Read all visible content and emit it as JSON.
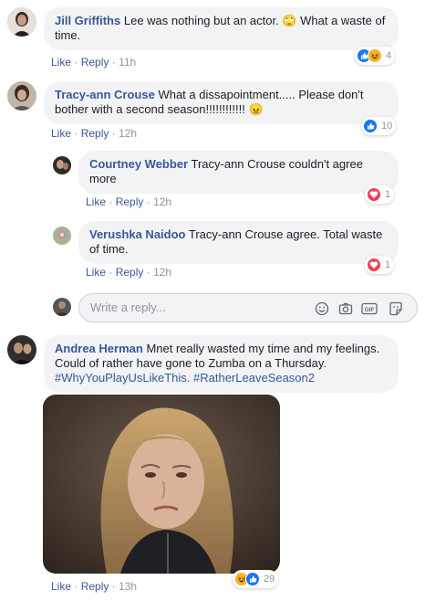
{
  "comments": [
    {
      "author": "Jill Griffiths",
      "text": "Lee was nothing but an actor. 🙄 What a waste of",
      "text_line2": "time.",
      "like": "Like",
      "reply": "Reply",
      "time": "11h",
      "reaction_count": "4",
      "reactions": [
        "like",
        "haha"
      ]
    },
    {
      "author": "Tracy-ann Crouse",
      "text": "What a dissapointment..... Please don't",
      "text_line2": "bother with a second season!!!!!!!!!!!! 😠",
      "like": "Like",
      "reply": "Reply",
      "time": "12h",
      "reaction_count": "10",
      "reactions": [
        "like"
      ]
    }
  ],
  "replies": [
    {
      "author": "Courtney Webber",
      "text": "Tracy-ann Crouse couldn't agree",
      "text_line2": "more",
      "like": "Like",
      "reply": "Reply",
      "time": "12h",
      "reaction_count": "1",
      "reactions": [
        "love"
      ]
    },
    {
      "author": "Verushka Naidoo",
      "text": "Tracy-ann Crouse agree. Total waste",
      "text_line2": "of time.",
      "like": "Like",
      "reply": "Reply",
      "time": "12h",
      "reaction_count": "1",
      "reactions": [
        "love"
      ]
    }
  ],
  "reply_box": {
    "placeholder": "Write a reply...",
    "icons": [
      "emoji-icon",
      "camera-icon",
      "gif-icon",
      "sticker-icon"
    ]
  },
  "last_comment": {
    "author": "Andrea Herman",
    "text": "Mnet really wasted my time and my feelings.",
    "text_line2": "Could of rather have gone to Zumba on a Thursday.",
    "hashtag1": "#WhyYouPlayUsLikeThis.",
    "hashtag2": "#RatherLeaveSeason2",
    "like": "Like",
    "reply": "Reply",
    "time": "13h",
    "reaction_count": "29",
    "reactions": [
      "haha",
      "like"
    ]
  },
  "colors": {
    "link": "#385898",
    "bubble": "#f2f3f5",
    "muted": "#90949c",
    "like_blue": "#1877f2",
    "love_red": "#f33e58",
    "haha_yellow": "#f7b125"
  }
}
